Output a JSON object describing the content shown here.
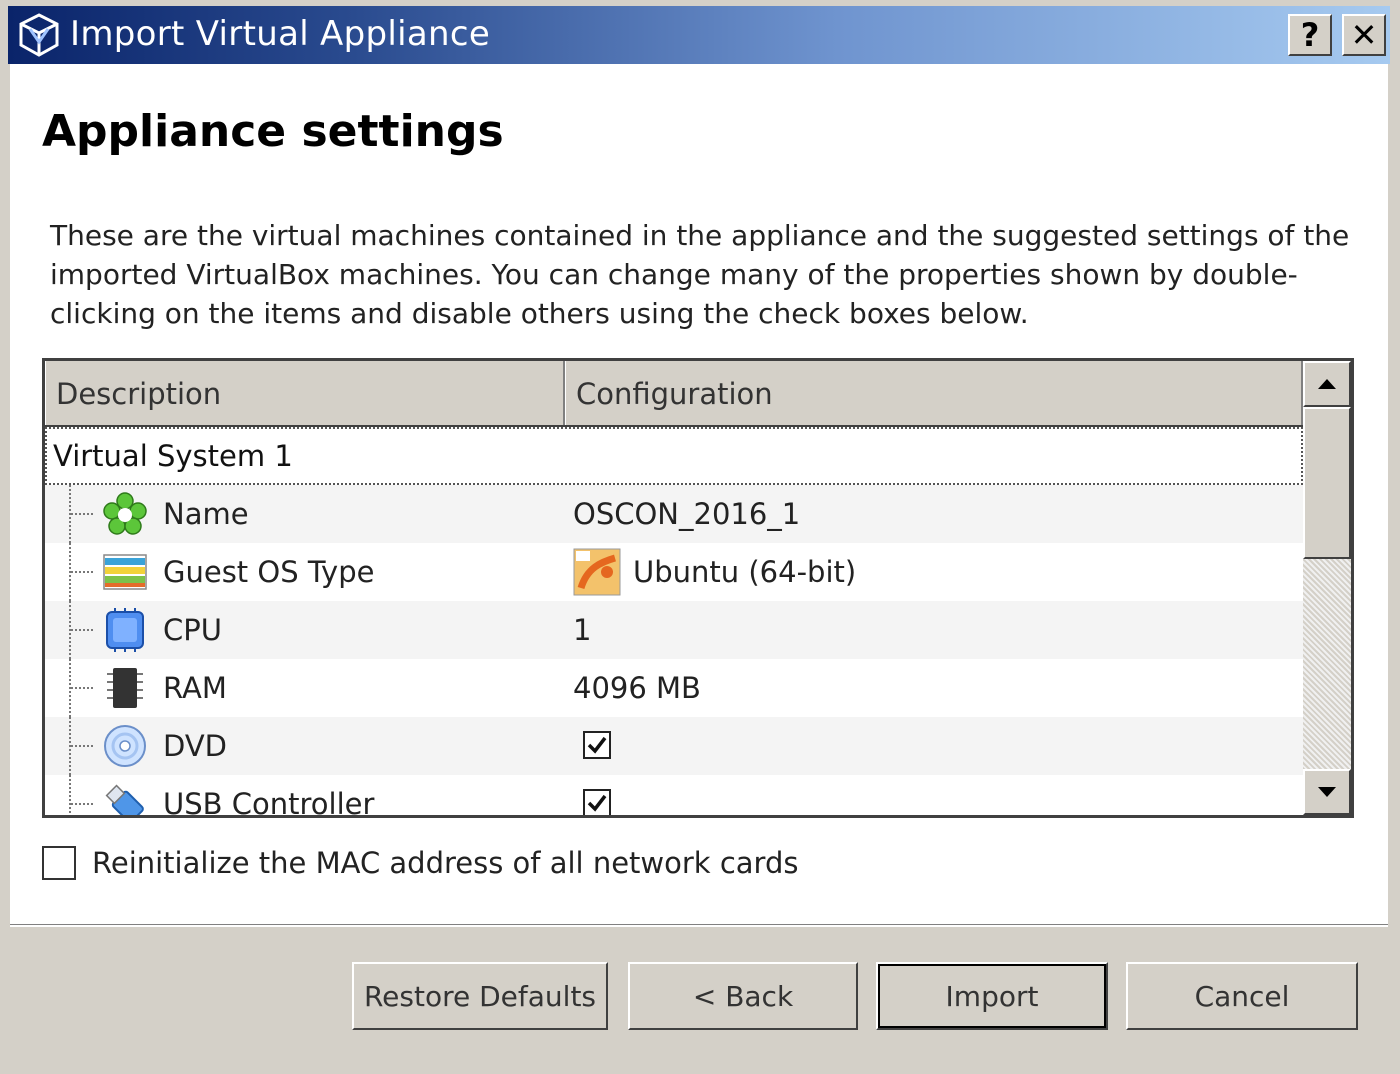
{
  "window": {
    "title": "Import Virtual Appliance",
    "help_glyph": "?",
    "close_glyph": "✕"
  },
  "page": {
    "heading": "Appliance settings",
    "description": "These are the virtual machines contained in the appliance and the suggested settings of the imported VirtualBox machines. You can change many of the properties shown by double-clicking on the items and disable others using the check boxes below."
  },
  "table": {
    "columns": [
      "Description",
      "Configuration"
    ],
    "group": "Virtual System 1",
    "rows": [
      {
        "label": "Name",
        "value": "OSCON_2016_1",
        "icon": "name-icon"
      },
      {
        "label": "Guest OS Type",
        "value": "Ubuntu (64-bit)",
        "icon": "guest-os-icon"
      },
      {
        "label": "CPU",
        "value": "1",
        "icon": "cpu-icon"
      },
      {
        "label": "RAM",
        "value": "4096 MB",
        "icon": "ram-icon"
      },
      {
        "label": "DVD",
        "checked": true,
        "icon": "dvd-icon"
      },
      {
        "label": "USB Controller",
        "checked": true,
        "icon": "usb-icon"
      }
    ]
  },
  "options": {
    "reinit_mac_label": "Reinitialize the MAC address of all network cards",
    "reinit_mac_checked": false
  },
  "buttons": {
    "restore": "Restore Defaults",
    "back": "< Back",
    "import": "Import",
    "cancel": "Cancel"
  }
}
